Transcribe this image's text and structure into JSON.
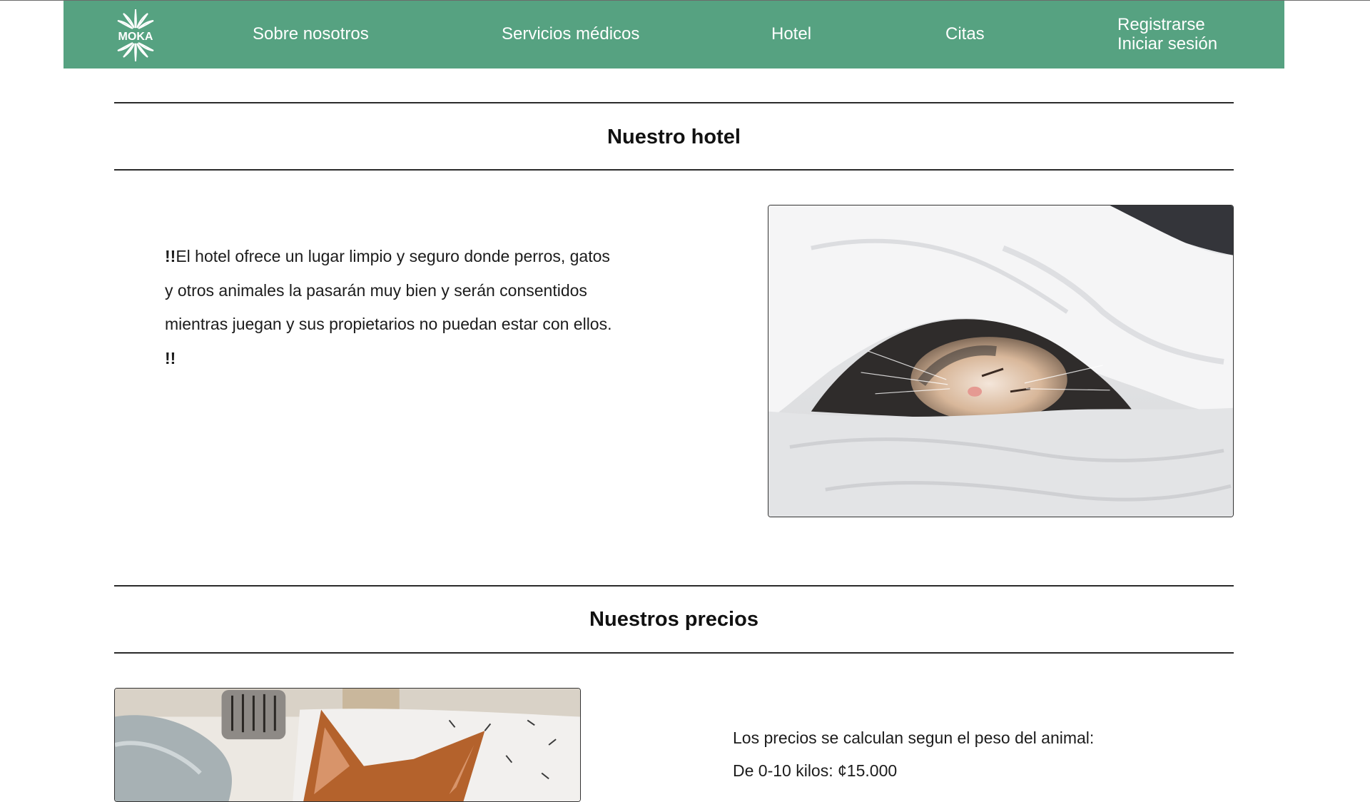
{
  "nav": {
    "logo_text": "MOKA",
    "about": "Sobre nosotros",
    "services": "Servicios médicos",
    "hotel": "Hotel",
    "appointments": "Citas",
    "register": "Registrarse",
    "login": "Iniciar sesión"
  },
  "hotel_section": {
    "title": "Nuestro hotel",
    "emphasis_open": "!!",
    "description": "El hotel ofrece un lugar limpio y seguro donde perros, gatos y otros animales la pasarán muy bien y serán consentidos mientras juegan y sus propietarios no puedan estar con ellos. ",
    "emphasis_close": "!!"
  },
  "prices_section": {
    "title": "Nuestros precios",
    "intro": "Los precios se calculan segun el peso del animal:",
    "first_tier": "De 0-10 kilos: ¢15.000"
  },
  "colors": {
    "nav_background": "#56a281",
    "nav_text": "#ffffff",
    "rule": "#2a2a2a"
  }
}
